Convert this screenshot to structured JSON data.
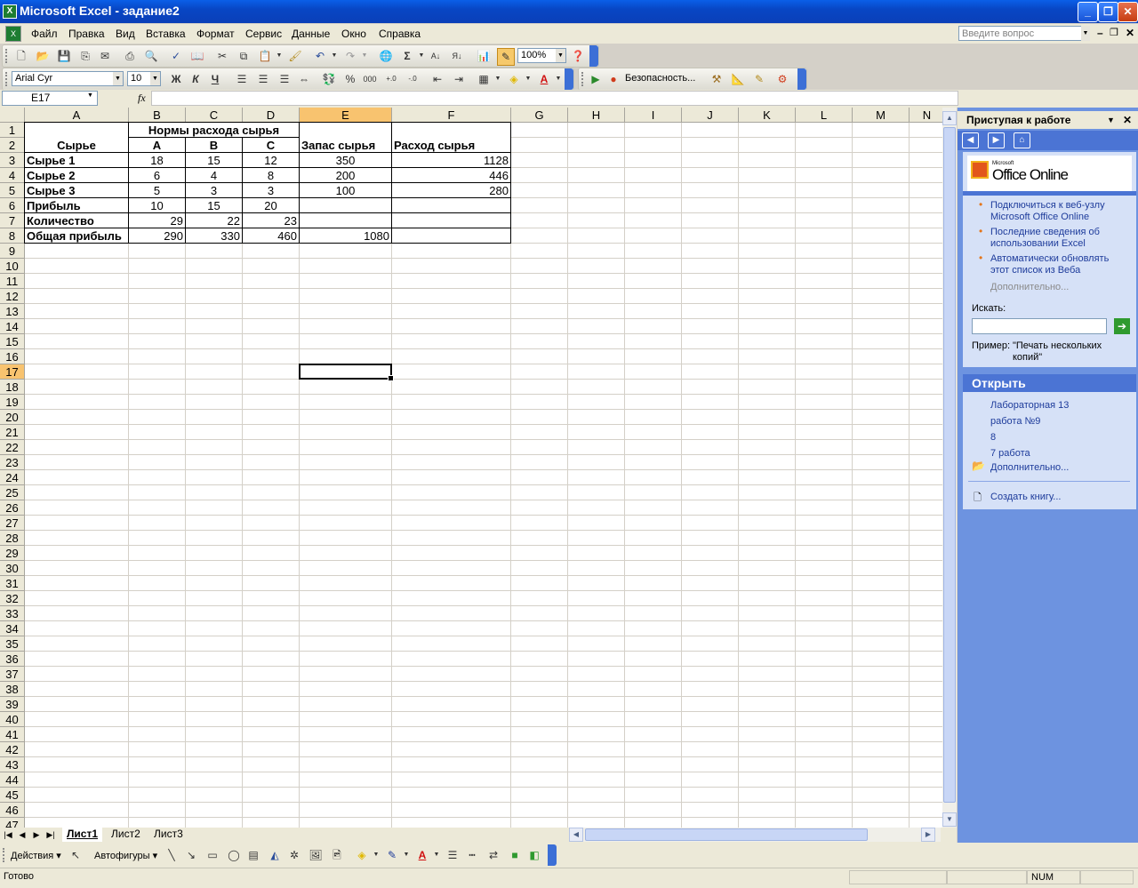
{
  "window": {
    "title": "Microsoft Excel - задание2",
    "app_icon": "excel-icon"
  },
  "menu": {
    "items": [
      "Файл",
      "Правка",
      "Вид",
      "Вставка",
      "Формат",
      "Сервис",
      "Данные",
      "Окно",
      "Справка"
    ],
    "ask_placeholder": "Введите вопрос"
  },
  "standard_toolbar": {
    "zoom": "100%"
  },
  "formatting_toolbar": {
    "font": "Arial Cyr",
    "size": "10",
    "bold": "Ж",
    "italic": "К",
    "underline": "Ч",
    "percent": "%",
    "thousands": "000",
    "security": "Безопасность..."
  },
  "formula_bar": {
    "name_box": "E17",
    "fx": "fx",
    "value": ""
  },
  "sheet": {
    "columns": [
      "A",
      "B",
      "C",
      "D",
      "E",
      "F",
      "G",
      "H",
      "I",
      "J",
      "K",
      "L",
      "M",
      "N"
    ],
    "selected_column": "E",
    "selected_row": 17,
    "rows": [
      1,
      2,
      3,
      4,
      5,
      6,
      7,
      8,
      9,
      10,
      11,
      12,
      13,
      14,
      15,
      16,
      17,
      18,
      19,
      20,
      21,
      22,
      23,
      24,
      25,
      26,
      27,
      28,
      29,
      30,
      31,
      32,
      33,
      34,
      35,
      36,
      37,
      38,
      39,
      40,
      41,
      42,
      43,
      44,
      45,
      46,
      47
    ],
    "cells": {
      "B1": "Нормы расхода сырья",
      "A2": "Сырье",
      "B2": "A",
      "C2": "B",
      "D2": "C",
      "E2": "Запас сырья",
      "F2": "Расход сырья",
      "A3": "Сырье 1",
      "B3": "18",
      "C3": "15",
      "D3": "12",
      "E3": "350",
      "F3": "1128",
      "A4": "Сырье 2",
      "B4": "6",
      "C4": "4",
      "D4": "8",
      "E4": "200",
      "F4": "446",
      "A5": "Сырье 3",
      "B5": "5",
      "C5": "3",
      "D5": "3",
      "E5": "100",
      "F5": "280",
      "A6": "Прибыль",
      "B6": "10",
      "C6": "15",
      "D6": "20",
      "A7": "Количество",
      "B7": "29",
      "C7": "22",
      "D7": "23",
      "A8": "Общая прибыль",
      "B8": "290",
      "C8": "330",
      "D8": "460",
      "E8": "1080"
    },
    "tabs": [
      "Лист1",
      "Лист2",
      "Лист3"
    ],
    "active_tab": "Лист1"
  },
  "task_pane": {
    "title": "Приступая к работе",
    "office_online_small": "Microsoft",
    "office_online": "Office Online",
    "links": [
      "Подключиться к веб-узлу Microsoft Office Online",
      "Последние сведения об использовании Excel",
      "Автоматически обновлять этот список из Веба"
    ],
    "more": "Дополнительно...",
    "search_label": "Искать:",
    "example_label": "Пример:",
    "example_text": "\"Печать нескольких копий\"",
    "open_header": "Открыть",
    "recent_files": [
      "Лабораторная 13",
      "работа №9",
      "8",
      "7 работа"
    ],
    "open_more": "Дополнительно...",
    "create_book": "Создать книгу..."
  },
  "drawing_toolbar": {
    "actions": "Действия",
    "autoshapes": "Автофигуры"
  },
  "status_bar": {
    "status": "Готово",
    "num": "NUM"
  },
  "colors": {
    "title_bar": "#0a4fd6",
    "selection_header": "#f8c36f",
    "task_pane": "#6d93e0",
    "link": "#1d3b9b"
  }
}
